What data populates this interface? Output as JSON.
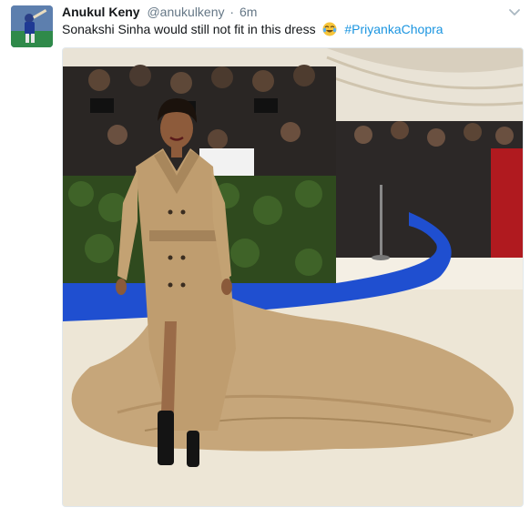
{
  "tweet": {
    "display_name": "Anukul Keny",
    "handle": "@anukulkeny",
    "separator": "·",
    "time": "6m",
    "text": "Sonakshi Sinha would still not fit in this dress",
    "emoji": "face-with-tears-of-joy",
    "hashtag": "#PriyankaChopra"
  },
  "icons": {
    "more": "chevron-down-icon",
    "avatar": "avatar"
  },
  "colors": {
    "name": "#14171a",
    "meta": "#657786",
    "hashtag": "#1b95e0",
    "carpet": "#1f4fd0",
    "dress": "#c6a67a"
  }
}
